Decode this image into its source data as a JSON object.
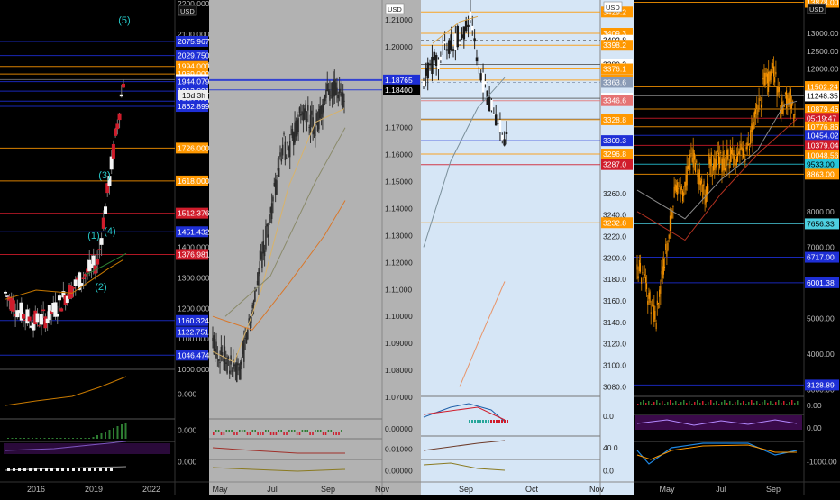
{
  "chart_data": [
    {
      "type": "candlestick",
      "id": "gold-monthly",
      "axis_ticks": [
        "2100.000",
        "2000.000",
        "1400.000",
        "1300.000",
        "1200.000",
        "1100.000",
        "1000.000",
        "2200.000"
      ],
      "ylim": [
        1000,
        2200
      ],
      "date_ticks": [
        "2016",
        "2019",
        "2022"
      ],
      "currency": "USD",
      "countdown": "10d 3h",
      "price_tags": [
        {
          "value": "2075.967",
          "y": 2075.967,
          "color": "#1e2fd6"
        },
        {
          "value": "2029.750",
          "y": 2029.75,
          "color": "#1e2fd6"
        },
        {
          "value": "1994.000",
          "y": 1994.0,
          "color": "#ff9800"
        },
        {
          "value": "1969.000",
          "y": 1969.0,
          "color": "#ff9800"
        },
        {
          "value": "1950.506",
          "y": 1950.506,
          "color": "#ffffff"
        },
        {
          "value": "1944.079",
          "y": 1944.079,
          "color": "#1e2fd6"
        },
        {
          "value": "1913.091",
          "y": 1913.091,
          "color": "#1e2fd6"
        },
        {
          "value": "1880.199",
          "y": 1880.199,
          "color": "#1e2fd6"
        },
        {
          "value": "1862.899",
          "y": 1862.899,
          "color": "#1e2fd6"
        },
        {
          "value": "1726.000",
          "y": 1726.0,
          "color": "#ff9800"
        },
        {
          "value": "1618.000",
          "y": 1618.0,
          "color": "#ff9800"
        },
        {
          "value": "1512.376",
          "y": 1512.376,
          "color": "#d01c2b"
        },
        {
          "value": "1451.432",
          "y": 1451.432,
          "color": "#1e2fd6"
        },
        {
          "value": "1376.981",
          "y": 1376.981,
          "color": "#d01c2b"
        },
        {
          "value": "1160.324",
          "y": 1160.324,
          "color": "#1e2fd6"
        },
        {
          "value": "1122.751",
          "y": 1122.751,
          "color": "#1e2fd6"
        },
        {
          "value": "1046.474",
          "y": 1046.474,
          "color": "#1e2fd6"
        }
      ],
      "wave_labels": [
        "(5)",
        "(3)",
        "(1)",
        "(4)",
        "(2)"
      ],
      "sub_ticks": [
        "0.000",
        "0.000",
        "0.000"
      ]
    },
    {
      "type": "candlestick",
      "id": "eurusd-daily",
      "currency": "USD",
      "axis_ticks": [
        "1.21000",
        "1.20000",
        "1.17000",
        "1.16000",
        "1.15000",
        "1.14000",
        "1.13000",
        "1.12000",
        "1.11000",
        "1.10000",
        "1.09000",
        "1.08000",
        "1.07000"
      ],
      "ylim": [
        1.062,
        1.216
      ],
      "price_tags": [
        {
          "value": "1.18765",
          "y": 1.18765,
          "color": "#1e2fd6"
        },
        {
          "value": "1.18400",
          "y": 1.184,
          "color": "#000000"
        }
      ],
      "date_ticks": [
        "May",
        "Jul",
        "Sep",
        "Nov"
      ],
      "sub_ticks": [
        "0.00000",
        "0.01000",
        "0.00000"
      ]
    },
    {
      "type": "candlestick",
      "id": "sp500-daily",
      "currency": "USD",
      "axis_ticks": [
        "3260.0",
        "3240.0",
        "3220.0",
        "3200.0",
        "3180.0",
        "3160.0",
        "3140.0",
        "3120.0",
        "3100.0",
        "3080.0"
      ],
      "ylim": [
        3071,
        3437
      ],
      "price_tags": [
        {
          "value": "3429.2",
          "y": 3429.2,
          "color": "#ff9800"
        },
        {
          "value": "3409.3",
          "y": 3409.3,
          "color": "#ff9800"
        },
        {
          "value": "3402.8",
          "y": 3402.8,
          "color": "#ffffff"
        },
        {
          "value": "3398.2",
          "y": 3398.2,
          "color": "#ff9800"
        },
        {
          "value": "3380.3",
          "y": 3380.3,
          "color": "#ffffff"
        },
        {
          "value": "3376.1",
          "y": 3376.1,
          "color": "#ff9800"
        },
        {
          "value": "3365.8",
          "y": 3365.8,
          "color": "#ff9800"
        },
        {
          "value": "3363.6",
          "y": 3363.6,
          "color": "#8a9bb5"
        },
        {
          "value": "3348.8",
          "y": 3348.8,
          "color": "#ffffff"
        },
        {
          "value": "3346.6",
          "y": 3346.6,
          "color": "#e57373"
        },
        {
          "value": "3329.3",
          "y": 3329.3,
          "color": "#ffffff"
        },
        {
          "value": "3328.8",
          "y": 3328.8,
          "color": "#ff9800"
        },
        {
          "value": "3309.3",
          "y": 3309.3,
          "color": "#1e2fd6"
        },
        {
          "value": "3296.8",
          "y": 3296.8,
          "color": "#ff9800"
        },
        {
          "value": "3287.0",
          "y": 3287.0,
          "color": "#d01c2b"
        },
        {
          "value": "3232.8",
          "y": 3232.8,
          "color": "#ff9800"
        }
      ],
      "date_ticks": [
        "Sep",
        "Oct",
        "Nov"
      ],
      "sub_ticks": [
        "0.0",
        "40.0",
        "0.0"
      ]
    },
    {
      "type": "candlestick",
      "id": "btcusd-daily",
      "currency": "USD",
      "axis_ticks": [
        "13000.00",
        "12500.00",
        "12000.00",
        "9000.00",
        "8000.00",
        "7000.00",
        "5000.00",
        "4000.00",
        "3000.00"
      ],
      "ylim": [
        2810,
        13840
      ],
      "price_tags": [
        {
          "value": "13878.00",
          "y": 13878,
          "color": "#ff9800"
        },
        {
          "value": "11511.00",
          "y": 11511,
          "color": "#ff9800"
        },
        {
          "value": "11502.24",
          "y": 11502.24,
          "color": "#ff9800"
        },
        {
          "value": "11248.35",
          "y": 11248.35,
          "color": "#ffffff"
        },
        {
          "value": "10879.46",
          "y": 10879.46,
          "color": "#ff9800"
        },
        {
          "value": "05:19:47",
          "y": 10620,
          "color": "#d01c2b"
        },
        {
          "value": "10776.86",
          "y": 10380,
          "color": "#ff9800"
        },
        {
          "value": "10454.02",
          "y": 10140,
          "color": "#1e2fd6"
        },
        {
          "value": "10379.04",
          "y": 9860,
          "color": "#d01c2b"
        },
        {
          "value": "10048.56",
          "y": 9580,
          "color": "#ff9800"
        },
        {
          "value": "9533.00",
          "y": 9330,
          "color": "#26c6da"
        },
        {
          "value": "8863.00",
          "y": 9050,
          "color": "#ff9800"
        },
        {
          "value": "7656.33",
          "y": 7656.33,
          "color": "#4dd0e1"
        },
        {
          "value": "6717.00",
          "y": 6717,
          "color": "#1e2fd6"
        },
        {
          "value": "6001.38",
          "y": 6001.38,
          "color": "#1e2fd6"
        },
        {
          "value": "3128.89",
          "y": 3128.89,
          "color": "#1e2fd6"
        }
      ],
      "date_ticks": [
        "May",
        "Jul",
        "Sep"
      ],
      "sub_ticks": [
        "0.00",
        "0.00",
        "-1000.00"
      ]
    }
  ]
}
